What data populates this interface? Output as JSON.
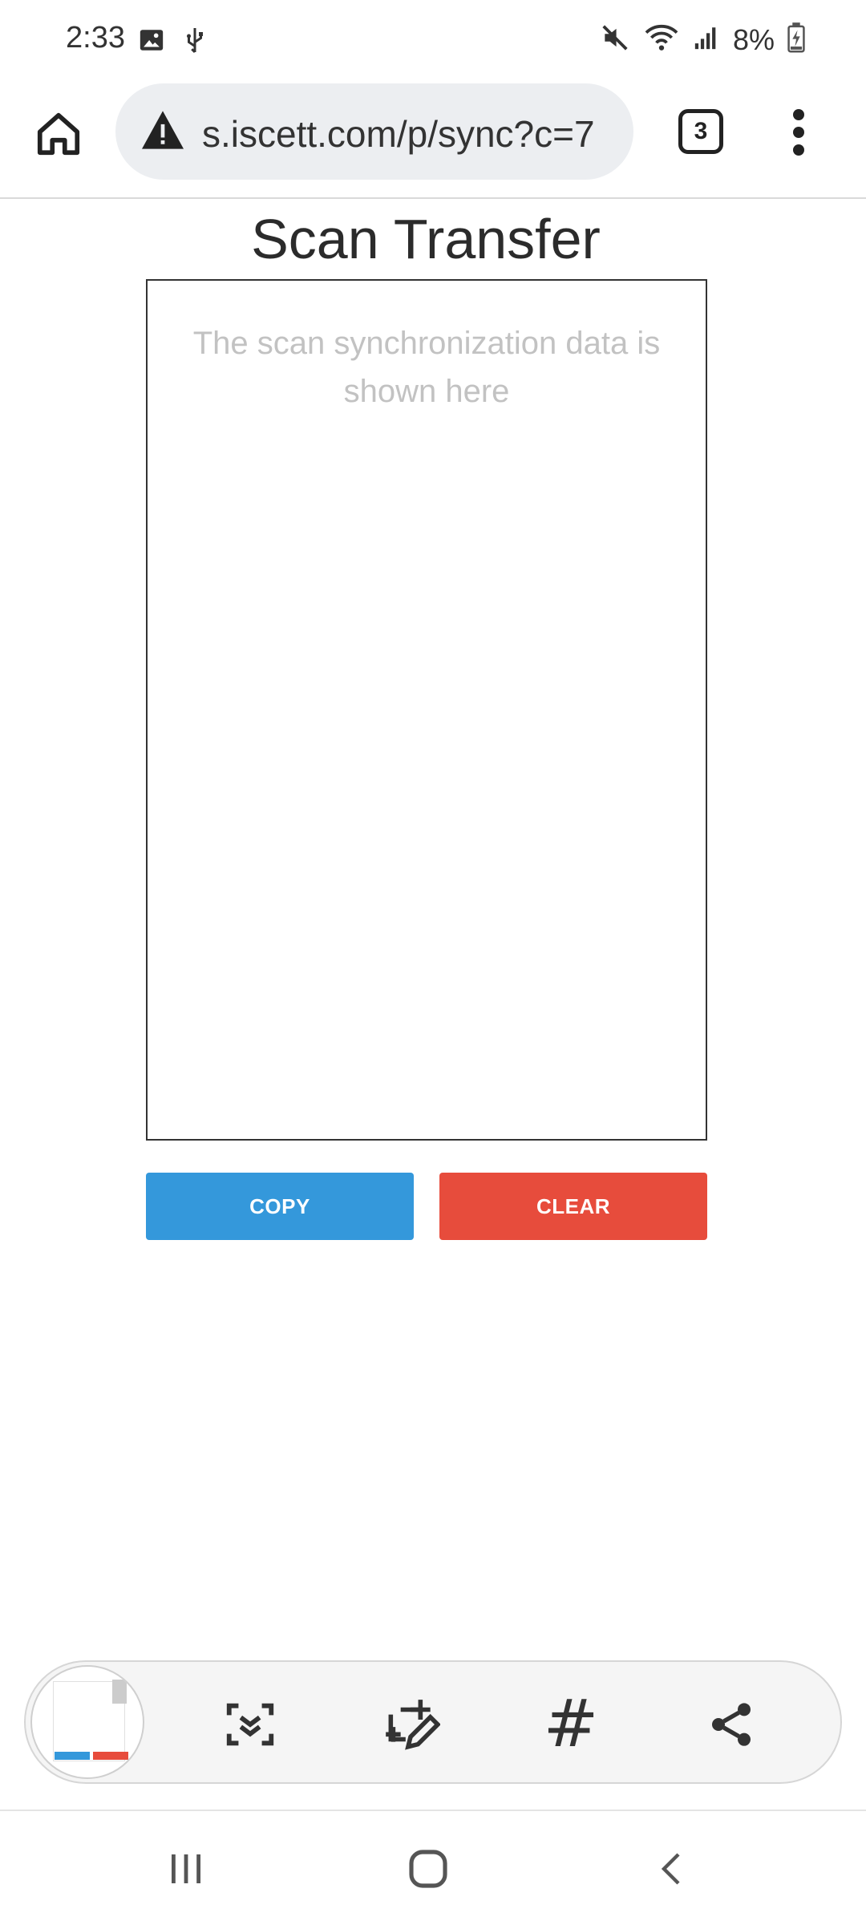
{
  "status_bar": {
    "time": "2:33",
    "battery": "8%",
    "left_icons": [
      "image-icon",
      "usb-icon"
    ],
    "right_icons": [
      "mute-icon",
      "wifi-icon",
      "signal-icon",
      "battery-charging-icon"
    ]
  },
  "browser": {
    "url": "s.iscett.com/p/sync?c=7",
    "tab_count": "3",
    "icons": [
      "home-icon",
      "warning-icon",
      "more-vert-icon"
    ]
  },
  "page": {
    "title": "Scan Transfer",
    "textarea_placeholder": "The scan synchronization data is shown here",
    "copy_label": "COPY",
    "clear_label": "CLEAR",
    "colors": {
      "copy": "#3498db",
      "clear": "#e74c3c"
    }
  },
  "screenshot_toolbar": {
    "hashtag_label": "#",
    "icons": [
      "scroll-capture-icon",
      "draw-icon",
      "hashtag-icon",
      "share-icon"
    ]
  },
  "nav_bar": {
    "icons": [
      "recent-apps-icon",
      "home-nav-icon",
      "back-icon"
    ]
  }
}
